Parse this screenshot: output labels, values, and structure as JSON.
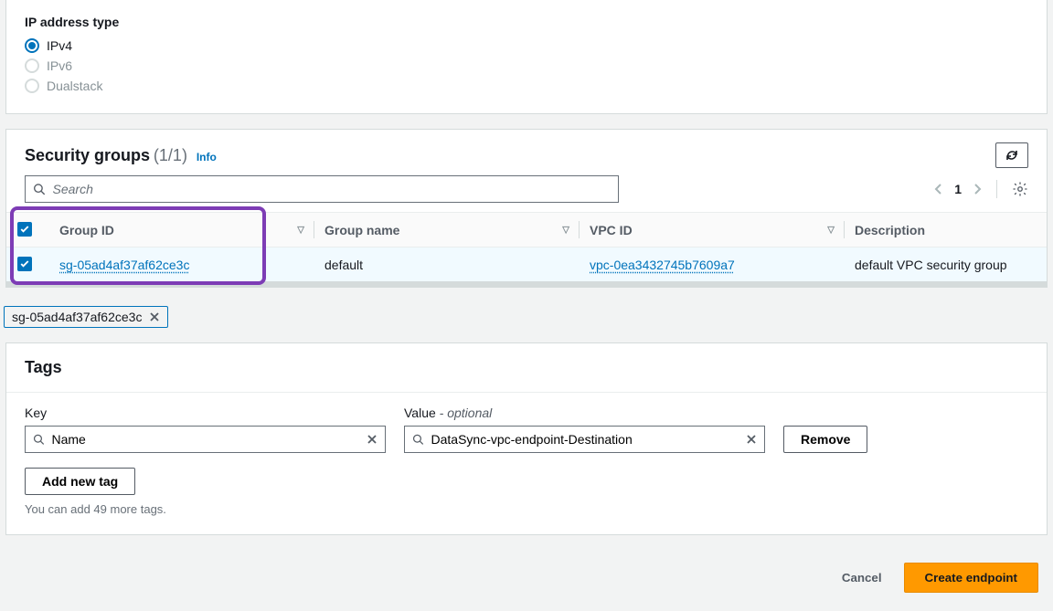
{
  "ip_section": {
    "title": "IP address type",
    "options": {
      "ipv4": {
        "label": "IPv4",
        "selected": true,
        "enabled": true
      },
      "ipv6": {
        "label": "IPv6",
        "selected": false,
        "enabled": false
      },
      "dual": {
        "label": "Dualstack",
        "selected": false,
        "enabled": false
      }
    }
  },
  "security_groups": {
    "title": "Security groups",
    "count": "(1/1)",
    "info": "Info",
    "search_placeholder": "Search",
    "page_number": "1",
    "columns": {
      "group_id": "Group ID",
      "group_name": "Group name",
      "vpc_id": "VPC ID",
      "description": "Description"
    },
    "row": {
      "group_id": "sg-05ad4af37af62ce3c",
      "group_name": "default",
      "vpc_id": "vpc-0ea3432745b7609a7",
      "description": "default VPC security group"
    },
    "chip": "sg-05ad4af37af62ce3c"
  },
  "tags": {
    "title": "Tags",
    "key_label": "Key",
    "value_label": "Value",
    "optional": " - optional",
    "key_value": "Name",
    "value_value": "DataSync-vpc-endpoint-Destination",
    "remove": "Remove",
    "add": "Add new tag",
    "hint": "You can add 49 more tags."
  },
  "footer": {
    "cancel": "Cancel",
    "create": "Create endpoint"
  }
}
